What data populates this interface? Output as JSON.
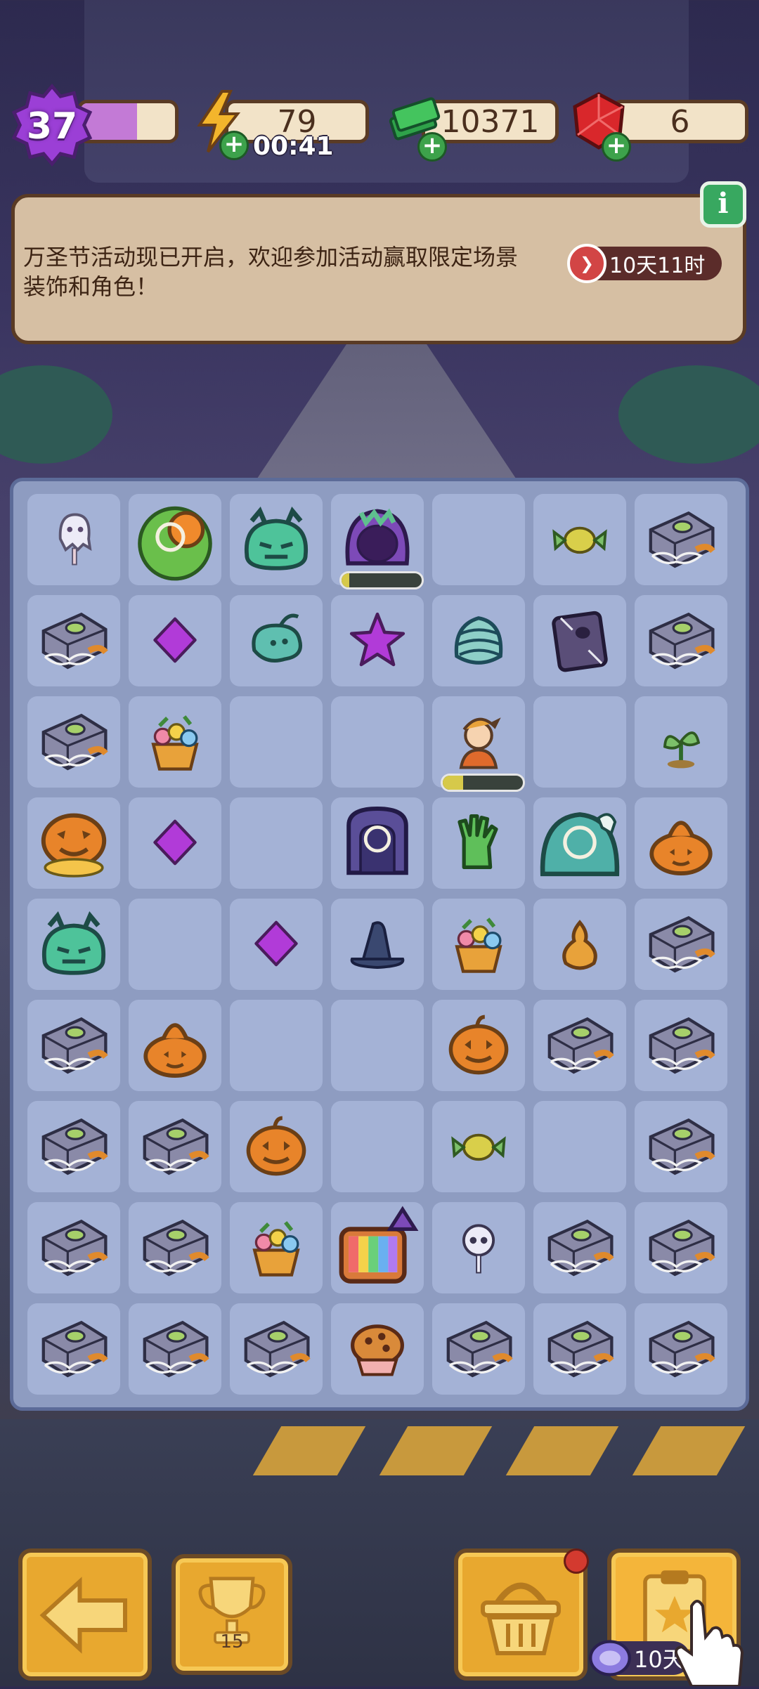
{
  "hud": {
    "level": "37",
    "level_progress": 0.6,
    "energy": "79",
    "energy_timer": "00:41",
    "cash": "10371",
    "gems": "6"
  },
  "event": {
    "message": "万圣节活动现已开启，欢迎参加活动赢取限定场景装饰和角色！",
    "timer": "10天11时",
    "info_label": "i"
  },
  "board": {
    "rows": [
      [
        "ghost-lollipop",
        "pumpkin-bush-locked",
        "green-slime-monster",
        "purple-monster-producer",
        "",
        "candy-wrapper",
        "webbed-crate"
      ],
      [
        "webbed-crate",
        "purple-gem",
        "ghost-spirit",
        "purple-star",
        "mummy-swirl",
        "spider-book",
        "webbed-crate"
      ],
      [
        "webbed-crate",
        "flower-basket",
        "",
        "",
        "adventurer-producer",
        "",
        "sprout"
      ],
      [
        "jack-o-lantern-spill",
        "purple-gem",
        "",
        "gravestone-locked",
        "zombie-hand",
        "haunted-crypt-locked",
        "pumpkin-pile"
      ],
      [
        "green-slime-monster",
        "",
        "purple-gem",
        "witch-hat",
        "flower-basket",
        "gourd",
        "webbed-crate"
      ],
      [
        "webbed-crate",
        "pumpkin-pile",
        "",
        "",
        "jack-o-lantern",
        "webbed-crate",
        "webbed-crate"
      ],
      [
        "webbed-crate",
        "webbed-crate",
        "jack-o-lantern",
        "",
        "candy-wrapper",
        "",
        "webbed-crate"
      ],
      [
        "webbed-crate",
        "webbed-crate",
        "flower-basket",
        "retro-tv-witch",
        "skull-lollipop",
        "webbed-crate",
        "webbed-crate"
      ],
      [
        "webbed-crate",
        "webbed-crate",
        "webbed-crate",
        "cookie-bowl",
        "webbed-crate",
        "webbed-crate",
        "webbed-crate"
      ]
    ],
    "producer_progress": [
      0.1,
      0.25
    ]
  },
  "bottom": {
    "trophy_count": "15",
    "order_timer": "10天"
  }
}
